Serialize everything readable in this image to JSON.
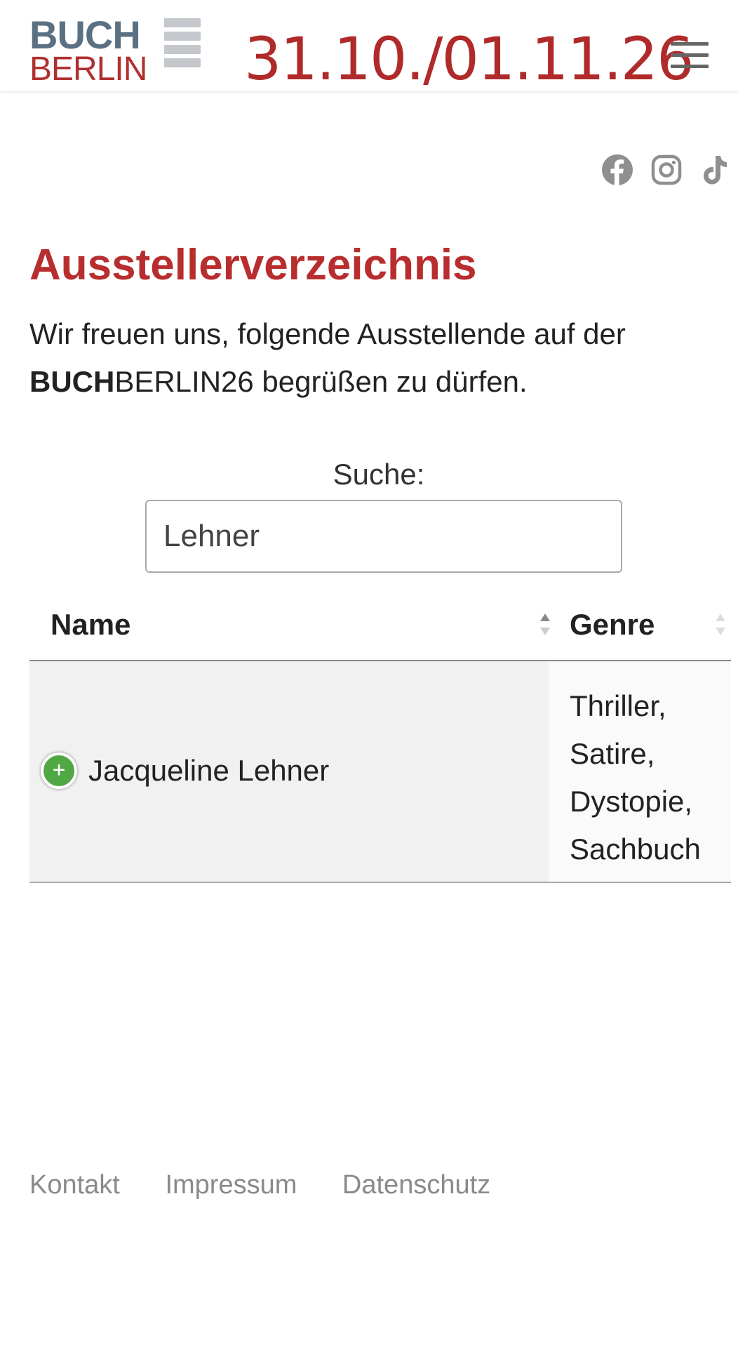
{
  "header": {
    "logo": {
      "line1": "BUCH",
      "line2": "BERLIN"
    },
    "date": "31.10./01.11.26",
    "menu_icon": "hamburger-menu-icon"
  },
  "social": [
    {
      "name": "facebook",
      "icon": "facebook-icon"
    },
    {
      "name": "instagram",
      "icon": "instagram-icon"
    },
    {
      "name": "tiktok",
      "icon": "tiktok-icon"
    }
  ],
  "main": {
    "title": "Ausstellerverzeichnis",
    "intro_prefix": "Wir freuen uns, folgende Ausstellende auf der",
    "intro_brand_bold": "BUCH",
    "intro_brand_rest": "BERLIN26 begrüßen zu dürfen."
  },
  "search": {
    "label": "Suche:",
    "value": "Lehner"
  },
  "table": {
    "columns": [
      "Name",
      "Genre"
    ],
    "rows": [
      {
        "name": "Jacqueline Lehner",
        "genres": [
          "Thriller,",
          "Satire,",
          "Dystopie,",
          "Sachbuch"
        ],
        "expand_icon": "+"
      }
    ]
  },
  "footer": {
    "links": [
      "Kontakt",
      "Impressum",
      "Datenschutz"
    ]
  },
  "colors": {
    "brand_red": "#b82e2e",
    "logo_gray": "#5b7083",
    "expand_green": "#4fa843",
    "footer_gray": "#8a8a8a"
  }
}
